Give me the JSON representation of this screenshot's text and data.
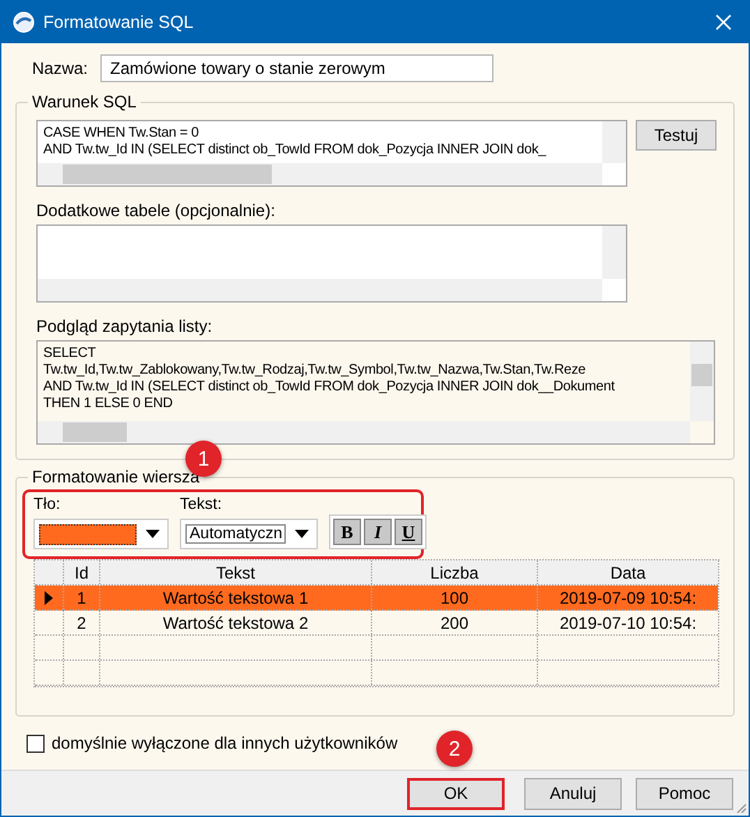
{
  "window": {
    "title": "Formatowanie SQL"
  },
  "name_field": {
    "label": "Nazwa:",
    "value": "Zamówione towary o stanie zerowym"
  },
  "sql_condition": {
    "legend": "Warunek SQL",
    "lines": [
      "CASE WHEN Tw.Stan = 0",
      "AND Tw.tw_Id IN (SELECT distinct ob_TowId FROM dok_Pozycja INNER JOIN dok_"
    ],
    "test_button": "Testuj"
  },
  "additional_tables": {
    "label": "Dodatkowe tabele (opcjonalnie):"
  },
  "preview": {
    "label": "Podgląd zapytania listy:",
    "lines": [
      "SELECT",
      "Tw.tw_Id,Tw.tw_Zablokowany,Tw.tw_Rodzaj,Tw.tw_Symbol,Tw.tw_Nazwa,Tw.Stan,Tw.Reze",
      "AND Tw.tw_Id IN (SELECT distinct ob_TowId FROM dok_Pozycja INNER JOIN dok__Dokument",
      "THEN 1 ELSE 0 END"
    ]
  },
  "row_format": {
    "legend": "Formatowanie wiersza",
    "background": {
      "label": "Tło:",
      "color": "#ff6a1f"
    },
    "text": {
      "label": "Tekst:",
      "value": "Automatyczn"
    },
    "style_buttons": [
      {
        "label": "B",
        "kind": "bold"
      },
      {
        "label": "I",
        "kind": "italic"
      },
      {
        "label": "U",
        "kind": "underline"
      }
    ]
  },
  "grid": {
    "columns": [
      "Id",
      "Tekst",
      "Liczba",
      "Data"
    ],
    "rows": [
      {
        "selected": true,
        "cells": [
          "1",
          "Wartość tekstowa 1",
          "100",
          "2019-07-09 10:54:"
        ]
      },
      {
        "selected": false,
        "cells": [
          "2",
          "Wartość tekstowa 2",
          "200",
          "2019-07-10 10:54:"
        ]
      }
    ]
  },
  "checkbox": {
    "label": "domyślnie wyłączone dla innych użytkowników",
    "checked": false
  },
  "buttons": [
    {
      "label": "OK",
      "highlighted": true
    },
    {
      "label": "Anuluj",
      "highlighted": false
    },
    {
      "label": "Pomoc",
      "highlighted": false
    }
  ],
  "callouts": [
    {
      "number": "1"
    },
    {
      "number": "2"
    }
  ]
}
